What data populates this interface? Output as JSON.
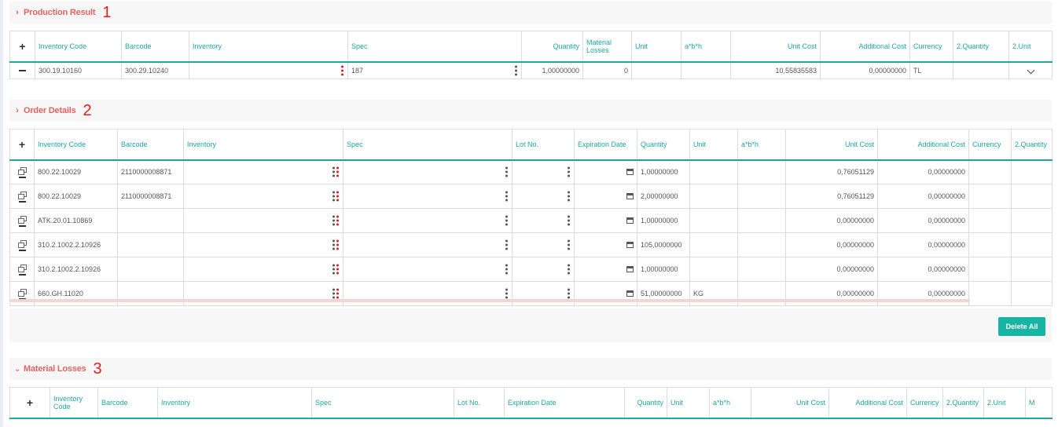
{
  "production_result": {
    "title": "Production Result",
    "number": "1",
    "columns": [
      "Inventory Code",
      "Barcode",
      "Inventory",
      "Spec",
      "Quantity",
      "Material Losses",
      "Unit",
      "a*b*h",
      "Unit Cost",
      "Additional Cost",
      "Currency",
      "2.Quantity",
      "2.Unit"
    ],
    "row": {
      "inventory_code": "300.19.10160",
      "barcode": "300.29.10240",
      "inventory": "",
      "spec": "187",
      "quantity": "1,00000000",
      "material_losses": "0",
      "unit": "",
      "abh": "",
      "unit_cost": "10,55835583",
      "additional_cost": "0,00000000",
      "currency": "TL",
      "quantity2": "",
      "unit2": ""
    }
  },
  "order_details": {
    "title": "Order Details",
    "number": "2",
    "columns": [
      "Inventory Code",
      "Barcode",
      "Inventory",
      "Spec",
      "Lot No.",
      "Expiration Date",
      "Quantity",
      "Unit",
      "a*b*h",
      "Unit Cost",
      "Additional Cost",
      "Currency",
      "2.Quantity"
    ],
    "rows": [
      {
        "inventory_code": "800.22.10029",
        "barcode": "2110000008871",
        "quantity": "1,00000000",
        "unit": "",
        "unit_cost": "0,76051129",
        "additional_cost": "0,00000000"
      },
      {
        "inventory_code": "800.22.10029",
        "barcode": "2110000008871",
        "quantity": "2,00000000",
        "unit": "",
        "unit_cost": "0,76051129",
        "additional_cost": "0,00000000"
      },
      {
        "inventory_code": "ATK.20.01.10869",
        "barcode": "",
        "quantity": "1,00000000",
        "unit": "",
        "unit_cost": "0,00000000",
        "additional_cost": "0,00000000"
      },
      {
        "inventory_code": "310.2.1002.2.10926",
        "barcode": "",
        "quantity": "105,0000000",
        "unit": "",
        "unit_cost": "0,00000000",
        "additional_cost": "0,00000000"
      },
      {
        "inventory_code": "310.2.1002.2.10926",
        "barcode": "",
        "quantity": "1,00000000",
        "unit": "",
        "unit_cost": "0,00000000",
        "additional_cost": "0,00000000"
      },
      {
        "inventory_code": "660.GH.11020",
        "barcode": "",
        "quantity": "51,00000000",
        "unit": "KG",
        "unit_cost": "0,00000000",
        "additional_cost": "0,00000000"
      }
    ],
    "delete_all_label": "Delete All"
  },
  "material_losses": {
    "title": "Material Losses",
    "number": "3",
    "columns": [
      "Inventory Code",
      "Barcode",
      "Inventory",
      "Spec",
      "Lot No.",
      "Expiration Date",
      "Quantity",
      "Unit",
      "a*b*h",
      "Unit Cost",
      "Additional Cost",
      "Currency",
      "2.Quantity",
      "2.Unit",
      "M"
    ]
  },
  "icons": {
    "collapsed": "chevron-right-icon",
    "expanded": "chevron-down-icon",
    "add": "plus-icon",
    "remove": "minus-icon",
    "copy": "copy-icon",
    "menu": "kebab-icon",
    "calendar": "calendar-icon"
  },
  "colors": {
    "accent": "#1fa7a0",
    "section_title": "#e06464",
    "section_number": "#e01e1e",
    "button": "#17b3a3",
    "required_dots": "#d02020"
  }
}
